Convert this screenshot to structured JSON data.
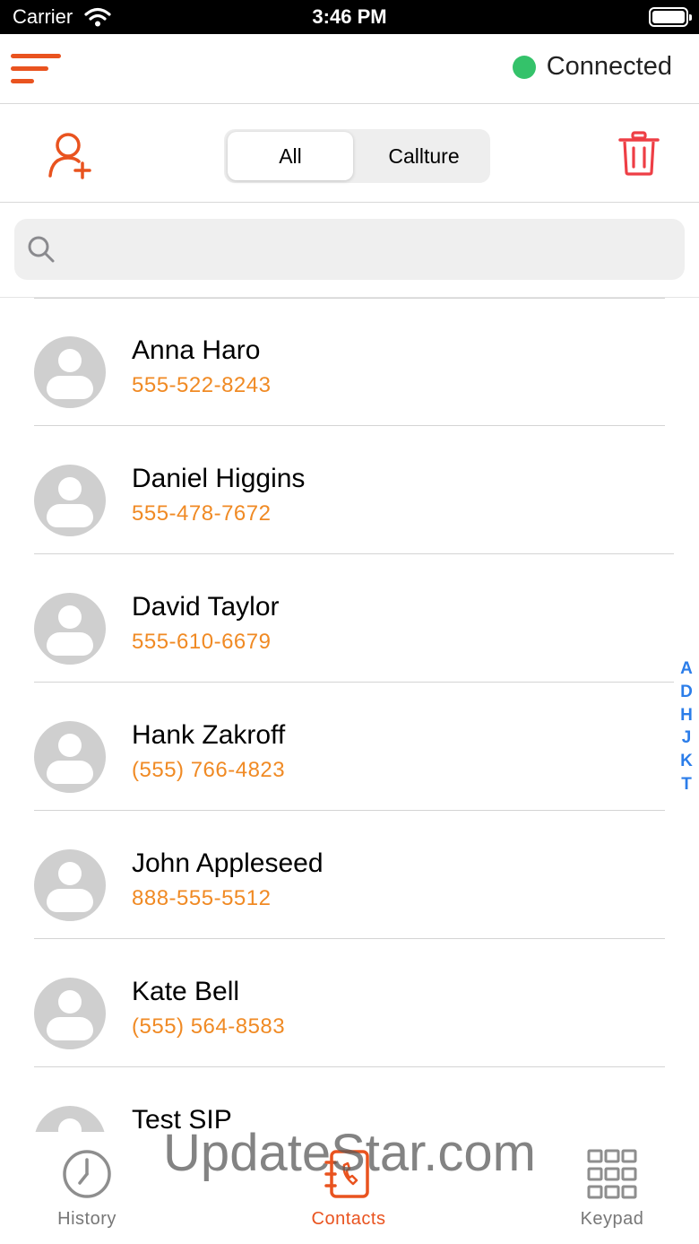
{
  "status_bar": {
    "carrier": "Carrier",
    "time": "3:46 PM"
  },
  "nav": {
    "connection_status": "Connected",
    "status_color": "#34c26a",
    "accent_color": "#e9531f"
  },
  "toolbar": {
    "segments": [
      "All",
      "Callture"
    ],
    "selected_segment": "All"
  },
  "search": {
    "placeholder": "",
    "value": ""
  },
  "contacts": [
    {
      "name": "Anna Haro",
      "phone": "555-522-8243"
    },
    {
      "name": "Daniel Higgins",
      "phone": "555-478-7672"
    },
    {
      "name": "David Taylor",
      "phone": "555-610-6679"
    },
    {
      "name": "Hank Zakroff",
      "phone": "(555) 766-4823"
    },
    {
      "name": "John Appleseed",
      "phone": "888-555-5512"
    },
    {
      "name": "Kate Bell",
      "phone": "(555) 564-8583"
    },
    {
      "name": "Test SIP",
      "phone": ""
    }
  ],
  "index_letters": [
    "A",
    "D",
    "H",
    "J",
    "K",
    "T"
  ],
  "tabs": [
    {
      "label": "History",
      "icon": "clock-icon"
    },
    {
      "label": "Contacts",
      "icon": "address-book-icon"
    },
    {
      "label": "Keypad",
      "icon": "keypad-grid-icon"
    }
  ],
  "selected_tab": "Contacts",
  "watermark": "UpdateStar.com"
}
